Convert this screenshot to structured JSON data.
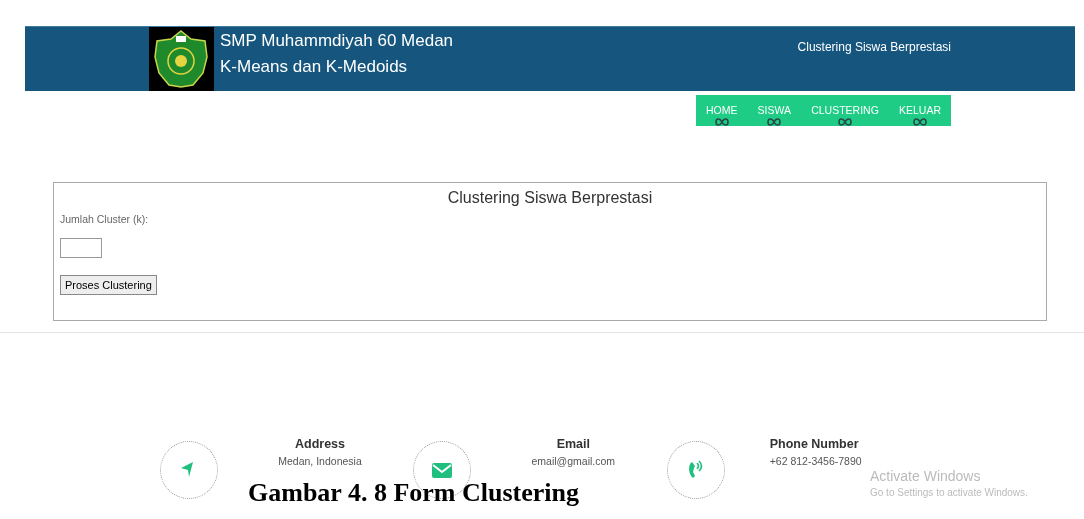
{
  "header": {
    "school": "SMP Muhammdiyah 60 Medan",
    "subtitle": "K-Means dan K-Medoids",
    "page_title": "Clustering Siswa Berprestasi"
  },
  "nav": [
    {
      "label": "HOME"
    },
    {
      "label": "SISWA"
    },
    {
      "label": "CLUSTERING"
    },
    {
      "label": "KELUAR"
    }
  ],
  "form": {
    "title": "Clustering Siswa Berprestasi",
    "field_label": "Jumlah Cluster (k):",
    "button": "Proses Clustering"
  },
  "footer": [
    {
      "kind": "address",
      "title": "Address",
      "text": "Medan, Indonesia"
    },
    {
      "kind": "email",
      "title": "Email",
      "text": "email@gmail.com"
    },
    {
      "kind": "phone",
      "title": "Phone Number",
      "text": "+62 812-3456-7890"
    }
  ],
  "caption": "Gambar 4. 8 Form Clustering",
  "os_notice": {
    "title": "Activate Windows",
    "text": "Go to Settings to activate Windows."
  }
}
